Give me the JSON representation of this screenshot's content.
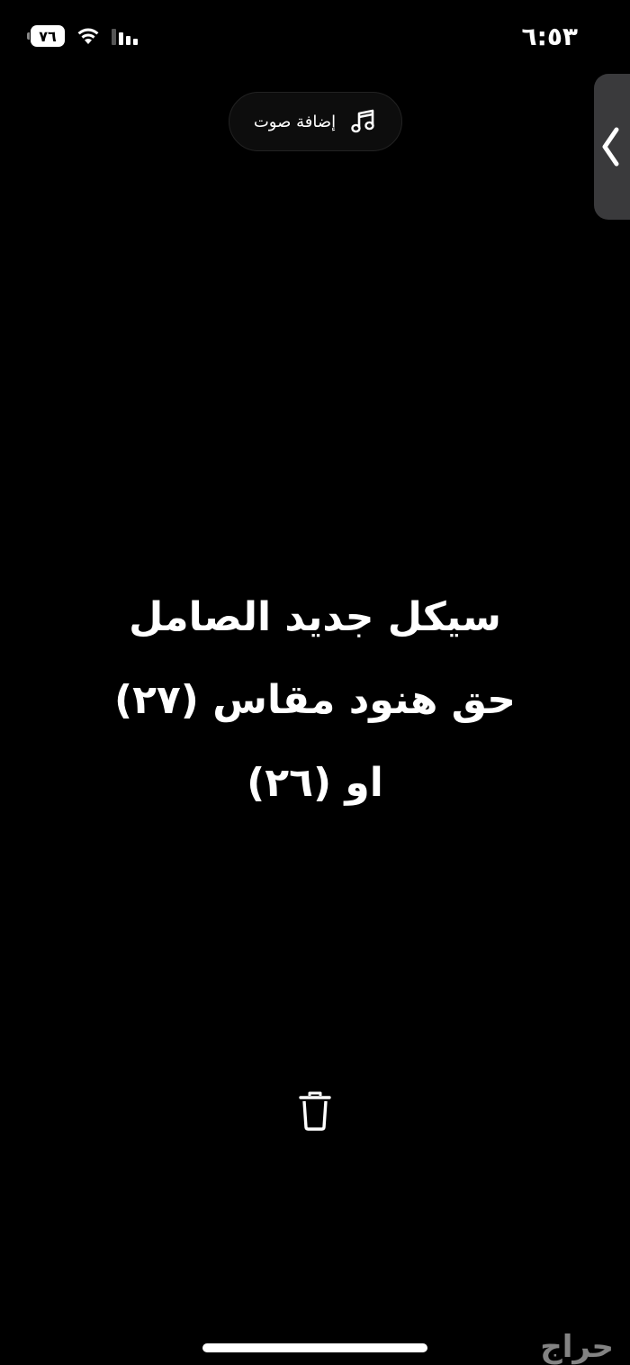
{
  "status_bar": {
    "time": "٦:٥٣",
    "battery_level": "٧٦",
    "wifi_icon": "wifi-icon",
    "signal_icon": "cellular-signal-icon"
  },
  "toolbar": {
    "add_audio_label": "إضافة صوت",
    "add_audio_icon": "music-note-icon"
  },
  "side_handle": {
    "icon": "chevron-left-icon"
  },
  "story": {
    "lines": [
      "سيكل جديد الصامل",
      "حق هنود مقاس (٢٧)",
      "او (٢٦)"
    ]
  },
  "delete": {
    "icon": "trash-icon"
  },
  "watermark": {
    "text": "حراج"
  },
  "colors": {
    "background": "#000000",
    "text": "#ffffff",
    "pill": "#0d0d0d",
    "handle": "#3a3a3c"
  }
}
